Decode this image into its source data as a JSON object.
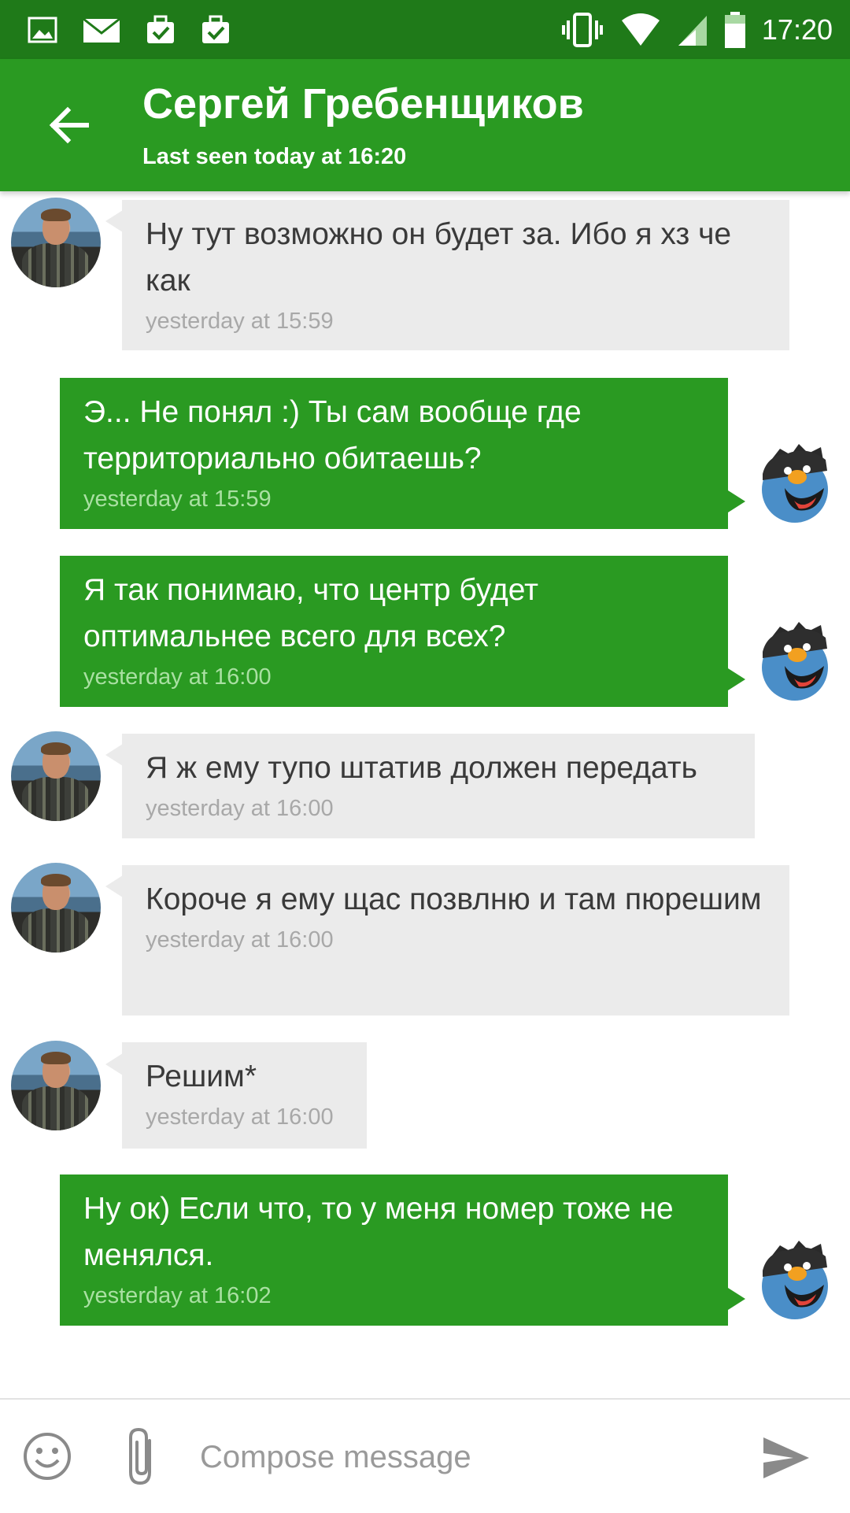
{
  "status_bar": {
    "time": "17:20",
    "left_icons": [
      "image-icon",
      "mail-icon",
      "briefcase-check-icon",
      "briefcase-check-icon"
    ],
    "right_icons": [
      "vibrate-icon",
      "wifi-icon",
      "signal-icon",
      "battery-icon"
    ]
  },
  "header": {
    "title": "Сергей Гребенщиков",
    "subtitle": "Last seen today at 16:20",
    "back_icon": "arrow-back-icon",
    "accent_color": "#2a9a22"
  },
  "messages": [
    {
      "direction": "in",
      "text": "Ну тут возможно он будет за. Ибо я хз че как",
      "time": "yesterday at 15:59"
    },
    {
      "direction": "out",
      "text": "Э... Не понял :) Ты сам вообще где территориально обитаешь?",
      "time": "yesterday at 15:59"
    },
    {
      "direction": "out",
      "text": "Я так понимаю, что центр будет оптимальнее всего для всех?",
      "time": "yesterday at 16:00"
    },
    {
      "direction": "in",
      "text": "Я ж ему тупо штатив должен передать",
      "time": "yesterday at 16:00"
    },
    {
      "direction": "in",
      "text": "Короче я ему щас позвлню и там пюрешим",
      "time": "yesterday at 16:00"
    },
    {
      "direction": "in",
      "text": "Решим*",
      "time": "yesterday at 16:00"
    },
    {
      "direction": "out",
      "text": "Ну ок) Если что, то у меня номер тоже не менялся.",
      "time": "yesterday at 16:02"
    }
  ],
  "composer": {
    "placeholder": "Compose message",
    "emoji_icon": "emoji-icon",
    "attach_icon": "paperclip-icon",
    "send_icon": "send-icon"
  }
}
